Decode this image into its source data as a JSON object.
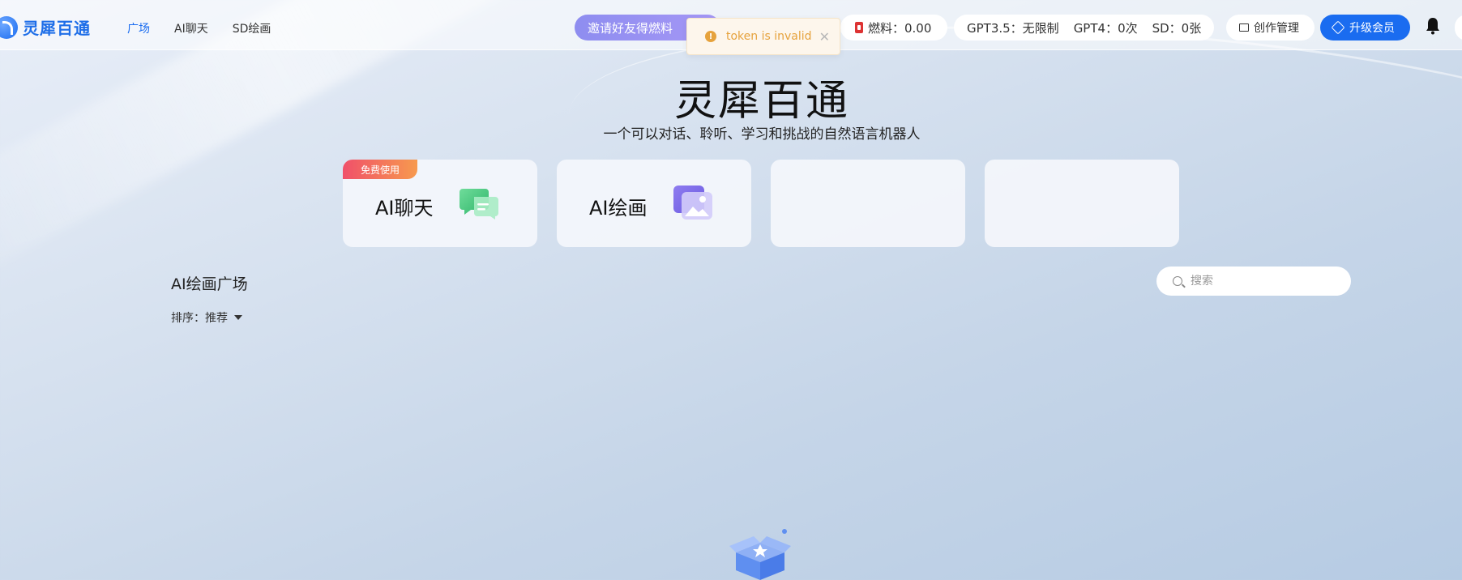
{
  "header": {
    "logo_text": "灵犀百通",
    "nav": [
      {
        "label": "广场",
        "active": true
      },
      {
        "label": "AI聊天",
        "active": false
      },
      {
        "label": "SD绘画",
        "active": false
      }
    ],
    "invite_label": "邀请好友得燃料",
    "fuel_label": "燃料：0.00",
    "quota": {
      "gpt35": "GPT3.5：无限制",
      "gpt4": "GPT4：0次",
      "sd": "SD：0张"
    },
    "manage_label": "创作管理",
    "upgrade_label": "升级会员"
  },
  "toast": {
    "text": "token is invalid",
    "icon": "warning-icon",
    "color": "#e6a23c"
  },
  "hero": {
    "title": "灵犀百通",
    "subtitle": "一个可以对话、聆听、学习和挑战的自然语言机器人"
  },
  "cards": [
    {
      "label": "AI聊天",
      "badge": "免费使用",
      "icon": "chat-bubble-icon"
    },
    {
      "label": "AI绘画",
      "badge": "",
      "icon": "image-icon"
    },
    {
      "label": "",
      "badge": "",
      "icon": ""
    },
    {
      "label": "",
      "badge": "",
      "icon": ""
    }
  ],
  "section": {
    "title": "AI绘画广场",
    "sort_label": "排序：推荐",
    "search_placeholder": "搜索"
  },
  "colors": {
    "primary": "#1a6cf0",
    "warning": "#e6a23c",
    "invite_gradient_start": "#8e8df0"
  }
}
